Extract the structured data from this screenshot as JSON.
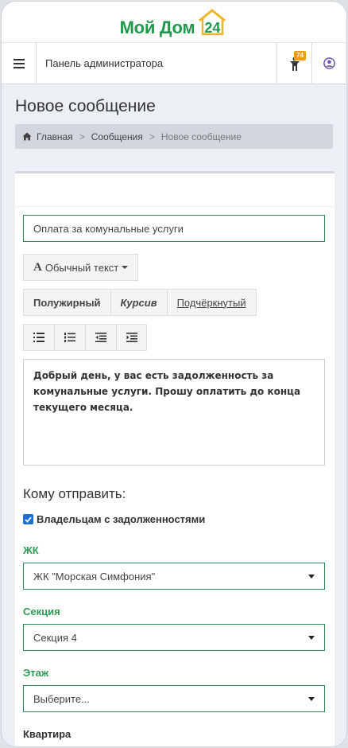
{
  "logo": {
    "text": "Мой Дом",
    "number": "24"
  },
  "navbar": {
    "title": "Панель администратора",
    "notifications_count": "74",
    "menu_icon": "hamburger-icon",
    "notif_icon": "person-icon",
    "user_icon": "user-circle-icon"
  },
  "header": {
    "page_title": "Новое сообщение",
    "breadcrumb": {
      "home": "Главная",
      "messages": "Сообщения",
      "current": "Новое сообщение"
    }
  },
  "form": {
    "subject": "Оплата за комунальные услуги",
    "text_style_label": "Обычный текст",
    "bold_label": "Полужирный",
    "italic_label": "Курсив",
    "underline_label": "Подчёркнутый",
    "message": "Добрый день, у вас есть задолженность за комунальные услуги. Прошу оплатить до конца текущего месяца.",
    "send_to_title": "Кому отправить:",
    "debtors_checkbox_label": "Владельцам с задолженностями",
    "debtors_checked": true,
    "complex_label": "ЖК",
    "complex_value": "ЖК \"Морская Симфония\"",
    "section_label": "Секция",
    "section_value": "Секция 4",
    "floor_label": "Этаж",
    "floor_value": "Выберите...",
    "apartment_label": "Квартира"
  },
  "colors": {
    "brand_green": "#1f9a4c",
    "badge": "#f39c12",
    "checkbox": "#1b6fd3"
  }
}
